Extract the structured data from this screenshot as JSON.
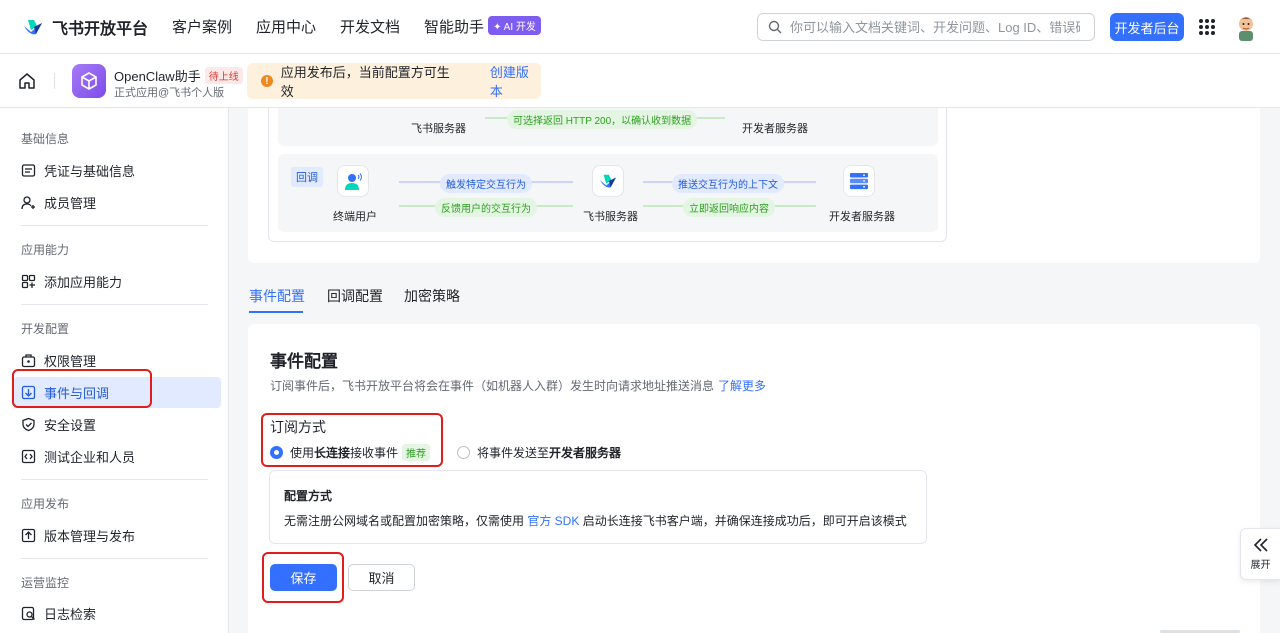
{
  "topnav": {
    "brand": "飞书开放平台",
    "links": [
      "客户案例",
      "应用中心",
      "开发文档",
      "智能助手"
    ],
    "ai_badge": "✦ AI 开发",
    "search_placeholder": "你可以输入文档关键词、开发问题、Log ID、错误码",
    "console_button": "开发者后台"
  },
  "subheader": {
    "app_name": "OpenClaw助手",
    "app_status": "待上线",
    "app_sub": "正式应用@飞书个人版",
    "notice_text": "应用发布后，当前配置方可生效",
    "notice_link": "创建版本"
  },
  "sidebar": {
    "group_basic": "基础信息",
    "item_credentials": "凭证与基础信息",
    "item_members": "成员管理",
    "group_ability": "应用能力",
    "item_add_ability": "添加应用能力",
    "group_dev": "开发配置",
    "item_permissions": "权限管理",
    "item_events": "事件与回调",
    "item_security": "安全设置",
    "item_test": "测试企业和人员",
    "group_publish": "应用发布",
    "item_version": "版本管理与发布",
    "group_ops": "运营监控",
    "item_logs": "日志检索"
  },
  "flow": {
    "top_left_label": "飞书服务器",
    "top_pill": "可选择返回 HTTP 200，以确认收到数据",
    "top_right_label": "开发者服务器",
    "callback_tag": "回调",
    "end_user": "终端用户",
    "pill_trigger": "触发特定交互行为",
    "pill_feedback": "反馈用户的交互行为",
    "feishu_server": "飞书服务器",
    "pill_push": "推送交互行为的上下文",
    "pill_return": "立即返回响应内容",
    "dev_server": "开发者服务器"
  },
  "tabs": [
    "事件配置",
    "回调配置",
    "加密策略"
  ],
  "event_config": {
    "title": "事件配置",
    "desc": "订阅事件后，飞书开放平台将会在事件（如机器人入群）发生时向请求地址推送消息",
    "learn_more": "了解更多",
    "subscription_label": "订阅方式",
    "option1_prefix": "使用 ",
    "option1_bold": "长连接",
    "option1_suffix": " 接收事件",
    "option1_tag": "推荐",
    "option2_prefix": "将事件发送至 ",
    "option2_bold": "开发者服务器",
    "conf_title": "配置方式",
    "conf_desc_1": "无需注册公网域名或配置加密策略，仅需使用 ",
    "conf_desc_link": "官方 SDK",
    "conf_desc_2": " 启动长连接飞书客户端，并确保连接成功后，即可开启该模式",
    "save": "保存",
    "cancel": "取消"
  },
  "expand_label": "展开",
  "colors": {
    "primary": "#3370ff",
    "highlight_box": "#e21b1b",
    "active_bg": "#e1eaff"
  }
}
